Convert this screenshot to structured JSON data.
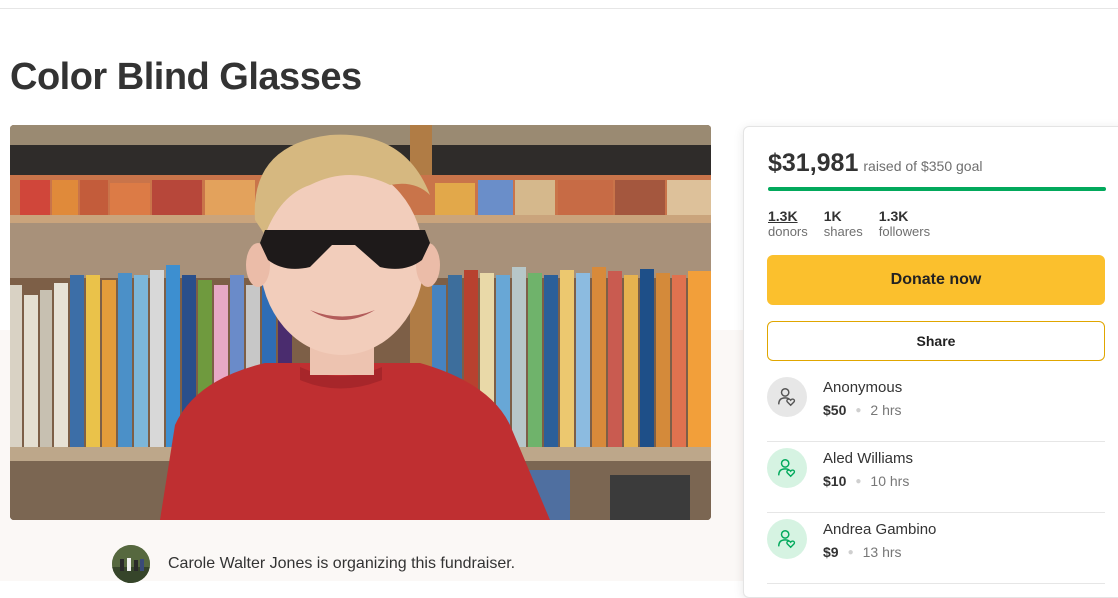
{
  "campaign": {
    "title": "Color Blind Glasses",
    "organizer_text": "Carole Walter Jones is organizing this fundraiser."
  },
  "donation_card": {
    "amount_raised": "$31,981",
    "goal_text": "raised of $350 goal",
    "progress_percent": 100,
    "stats": [
      {
        "value": "1.3K",
        "label": "donors"
      },
      {
        "value": "1K",
        "label": "shares"
      },
      {
        "value": "1.3K",
        "label": "followers"
      }
    ],
    "donate_label": "Donate now",
    "share_label": "Share"
  },
  "donors": [
    {
      "name": "Anonymous",
      "amount": "$50",
      "time": "2 hrs",
      "avatar_style": "anonymous"
    },
    {
      "name": "Aled Williams",
      "amount": "$10",
      "time": "10 hrs",
      "avatar_style": "named"
    },
    {
      "name": "Andrea Gambino",
      "amount": "$9",
      "time": "13 hrs",
      "avatar_style": "named"
    }
  ],
  "colors": {
    "donate_button": "#fbc02d",
    "share_border": "#e0a600",
    "progress": "#02a95c",
    "anonymous_avatar_bg": "#e7e7e7",
    "named_avatar_bg": "#d6f3e2",
    "anonymous_icon": "#555555",
    "named_icon": "#02a95c"
  },
  "icons": {
    "donor_avatar": "person-heart-icon"
  }
}
